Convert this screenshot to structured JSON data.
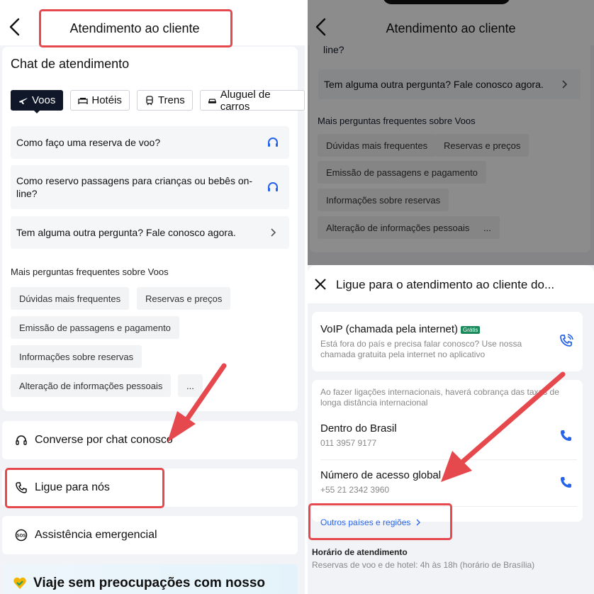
{
  "left": {
    "header_title": "Atendimento ao cliente",
    "chat_title": "Chat de atendimento",
    "tabs": [
      {
        "label": "Voos",
        "icon": "plane-icon",
        "active": true
      },
      {
        "label": "Hotéis",
        "icon": "bed-icon",
        "active": false
      },
      {
        "label": "Trens",
        "icon": "train-icon",
        "active": false
      },
      {
        "label": "Aluguel de carros",
        "icon": "car-icon",
        "active": false
      }
    ],
    "questions": [
      {
        "text": "Como faço uma reserva de voo?",
        "icon": "headset-icon"
      },
      {
        "text": "Como reservo passagens para crianças ou bebês on-line?",
        "icon": "headset-icon"
      },
      {
        "text": "Tem alguma outra pergunta? Fale conosco agora.",
        "icon": "chevron-right-icon"
      }
    ],
    "faq_title": "Mais perguntas frequentes sobre Voos",
    "faq_chips": [
      "Dúvidas mais frequentes",
      "Reservas e preços",
      "Emissão de passagens e pagamento",
      "Informações sobre reservas",
      "Alteração de informações pessoais",
      "..."
    ],
    "options": [
      {
        "label": "Converse por chat conosco",
        "icon": "headset-icon"
      },
      {
        "label": "Ligue para nós",
        "icon": "phone-icon"
      },
      {
        "label": "Assistência emergencial",
        "icon": "sos-icon"
      }
    ],
    "promo": "Viaje sem preocupações com nosso"
  },
  "right": {
    "header_title": "Atendimento ao cliente",
    "bg_partial": "line?",
    "bg_question": "Tem alguma outra pergunta? Fale conosco agora.",
    "bg_faq_title": "Mais perguntas frequentes sobre Voos",
    "bg_chips": [
      "Dúvidas mais frequentes",
      "Reservas e preços",
      "Emissão de passagens e pagamento",
      "Informações sobre reservas",
      "Alteração de informações pessoais",
      "..."
    ],
    "sheet_title": "Ligue para o atendimento ao cliente do...",
    "voip": {
      "title": "VoIP (chamada pela internet)",
      "badge": "Grátis",
      "desc": "Está fora do país e precisa falar conosco? Use nossa chamada gratuita pela internet no aplicativo"
    },
    "intl_note": "Ao fazer ligações internacionais, haverá cobrança das taxas de longa distância internacional",
    "phones": [
      {
        "label": "Dentro do Brasil",
        "number": "011 3957 9177"
      },
      {
        "label": "Número de acesso global",
        "number": "+55 21 2342 3960"
      }
    ],
    "other_link": "Outros países e regiões",
    "hours_title": "Horário de atendimento",
    "hours_text": "Reservas de voo e de hotel: 4h às 18h (horário de Brasília)"
  },
  "colors": {
    "accent_blue": "#2563eb",
    "highlight_red": "#e5484d",
    "tab_active": "#0f1729",
    "badge_green": "#1a8a5c"
  }
}
